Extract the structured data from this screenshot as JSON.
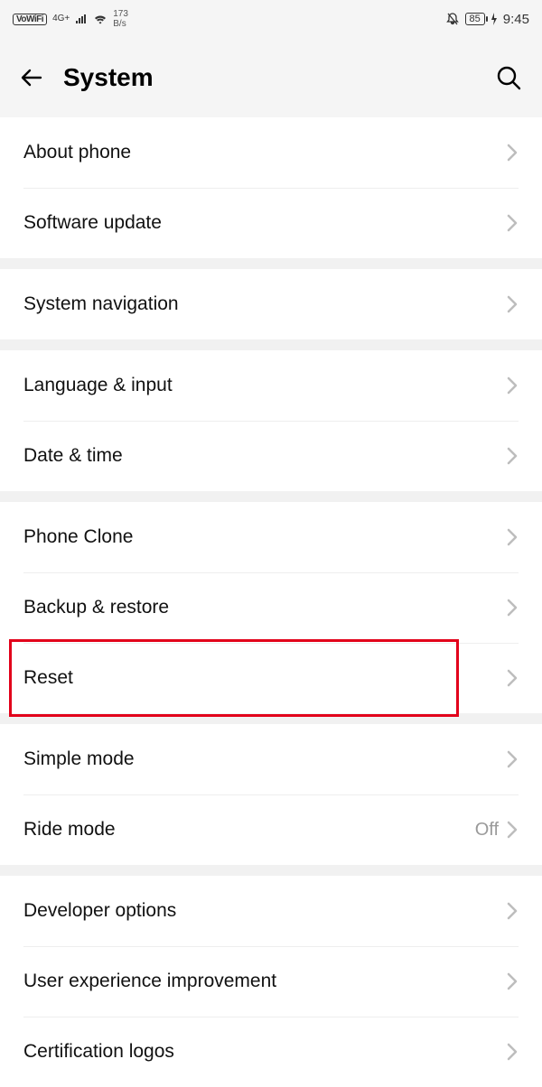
{
  "statusbar": {
    "vowifi": "VoWiFi",
    "network": "4G+",
    "speed_value": "173",
    "speed_unit": "B/s",
    "battery": "85",
    "time": "9:45"
  },
  "header": {
    "title": "System"
  },
  "groups": [
    {
      "rows": [
        {
          "key": "about",
          "label": "About phone"
        },
        {
          "key": "swupdate",
          "label": "Software update"
        }
      ]
    },
    {
      "rows": [
        {
          "key": "sysnav",
          "label": "System navigation"
        }
      ]
    },
    {
      "rows": [
        {
          "key": "lang",
          "label": "Language & input"
        },
        {
          "key": "datetime",
          "label": "Date & time"
        }
      ]
    },
    {
      "rows": [
        {
          "key": "phoneclone",
          "label": "Phone Clone"
        },
        {
          "key": "backup",
          "label": "Backup & restore"
        },
        {
          "key": "reset",
          "label": "Reset",
          "highlight": true
        }
      ]
    },
    {
      "rows": [
        {
          "key": "simplemode",
          "label": "Simple mode"
        },
        {
          "key": "ridemode",
          "label": "Ride mode",
          "value": "Off"
        }
      ]
    },
    {
      "rows": [
        {
          "key": "devopts",
          "label": "Developer options"
        },
        {
          "key": "uximprove",
          "label": "User experience improvement"
        },
        {
          "key": "certlogos",
          "label": "Certification logos"
        }
      ]
    }
  ]
}
